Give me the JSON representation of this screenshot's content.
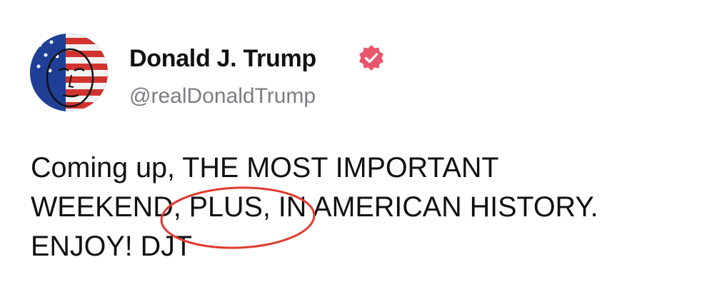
{
  "post": {
    "author": {
      "display_name": "Donald J. Trump",
      "handle": "@realDonaldTrump",
      "avatar": "flag-painted-face-avatar",
      "verified_icon": "verified-badge-icon"
    },
    "text": "Coming up, THE MOST IMPORTANT\nWEEKEND, PLUS, IN AMERICAN HISTORY.\nENJOY! DJT",
    "annotation": {
      "shape": "ellipse",
      "highlighted_text": "PLUS,",
      "color": "#e03b2e"
    }
  },
  "colors": {
    "background": "#ffffff",
    "text": "#111111",
    "handle": "#7c7c86",
    "verified": "#e8566b"
  }
}
